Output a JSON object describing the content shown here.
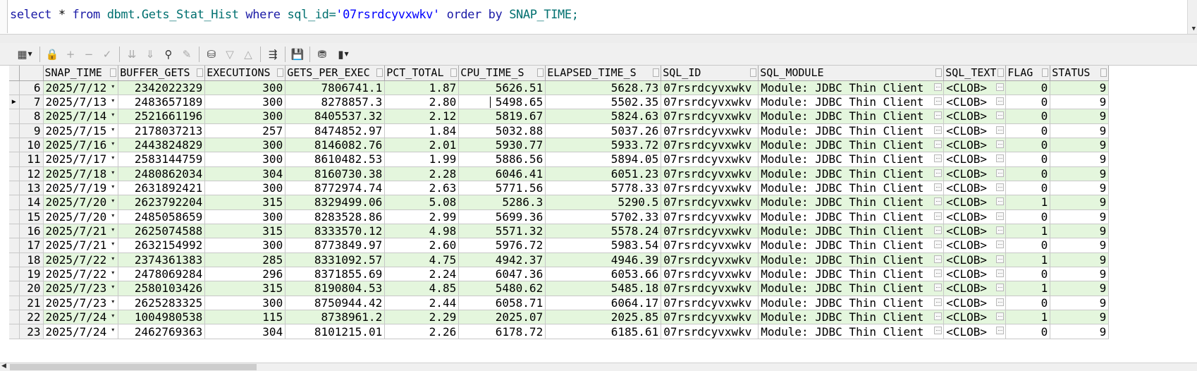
{
  "editor": {
    "sql_tokens": [
      {
        "t": "select",
        "c": "kw"
      },
      {
        "t": " * ",
        "c": "op"
      },
      {
        "t": "from",
        "c": "kw"
      },
      {
        "t": " dbmt.Gets_Stat_Hist ",
        "c": "obj"
      },
      {
        "t": "where",
        "c": "kw"
      },
      {
        "t": " sql_id=",
        "c": "obj"
      },
      {
        "t": "'07rsrdcyvxwkv'",
        "c": "str"
      },
      {
        "t": " order by ",
        "c": "kw"
      },
      {
        "t": "SNAP_TIME",
        "c": "obj"
      },
      {
        "t": ";",
        "c": "obj"
      }
    ]
  },
  "toolbar": {
    "buttons": [
      {
        "name": "grid-view-icon",
        "glyph": "▦",
        "dropdown": true,
        "enabled": true
      },
      {
        "sep": true
      },
      {
        "name": "lock-icon",
        "glyph": "🔒",
        "enabled": true
      },
      {
        "name": "insert-record-icon",
        "glyph": "+",
        "enabled": false
      },
      {
        "name": "delete-record-icon",
        "glyph": "−",
        "enabled": false
      },
      {
        "name": "post-changes-icon",
        "glyph": "✓",
        "enabled": false
      },
      {
        "sep": true
      },
      {
        "name": "fetch-next-icon",
        "glyph": "⇊",
        "enabled": false
      },
      {
        "name": "fetch-last-icon",
        "glyph": "⇓",
        "enabled": false
      },
      {
        "name": "find-icon",
        "glyph": "⚲",
        "enabled": true
      },
      {
        "name": "clear-icon",
        "glyph": "✎",
        "enabled": false
      },
      {
        "sep": true
      },
      {
        "name": "query-by-example-icon",
        "glyph": "⛁",
        "enabled": true
      },
      {
        "name": "filter-icon",
        "glyph": "▽",
        "enabled": false
      },
      {
        "name": "clear-filter-icon",
        "glyph": "△",
        "enabled": false
      },
      {
        "sep": true
      },
      {
        "name": "explain-plan-icon",
        "glyph": "⇶",
        "enabled": true
      },
      {
        "sep": true
      },
      {
        "name": "save-icon",
        "glyph": "💾",
        "enabled": true
      },
      {
        "sep": true
      },
      {
        "name": "export-icon",
        "glyph": "⛃",
        "enabled": true
      },
      {
        "name": "chart-icon",
        "glyph": "▮",
        "dropdown": true,
        "enabled": true
      }
    ]
  },
  "grid": {
    "columns": [
      {
        "key": "SNAP_TIME",
        "label": "SNAP_TIME",
        "width": 104,
        "align": "left",
        "dd": true
      },
      {
        "key": "BUFFER_GETS",
        "label": "BUFFER_GETS",
        "width": 123,
        "align": "right"
      },
      {
        "key": "EXECUTIONS",
        "label": "EXECUTIONS",
        "width": 114,
        "align": "right"
      },
      {
        "key": "GETS_PER_EXEC",
        "label": "GETS_PER_EXEC",
        "width": 141,
        "align": "right"
      },
      {
        "key": "PCT_TOTAL",
        "label": "PCT_TOTAL",
        "width": 105,
        "align": "right"
      },
      {
        "key": "CPU_TIME_S",
        "label": "CPU_TIME_S",
        "width": 123,
        "align": "right"
      },
      {
        "key": "ELAPSED_TIME_S",
        "label": "ELAPSED_TIME_S",
        "width": 164,
        "align": "right"
      },
      {
        "key": "SQL_ID",
        "label": "SQL_ID",
        "width": 138,
        "align": "left"
      },
      {
        "key": "SQL_MODULE",
        "label": "SQL_MODULE",
        "width": 263,
        "align": "left",
        "btn": true
      },
      {
        "key": "SQL_TEXT",
        "label": "SQL_TEXT",
        "width": 88,
        "align": "left",
        "btn": true
      },
      {
        "key": "FLAG",
        "label": "FLAG",
        "width": 63,
        "align": "right"
      },
      {
        "key": "STATUS",
        "label": "STATUS",
        "width": 83,
        "align": "right"
      }
    ],
    "current_row": 7,
    "rows": [
      {
        "n": "6",
        "SNAP_TIME": "2025/7/12",
        "BUFFER_GETS": "2342022329",
        "EXECUTIONS": "300",
        "GETS_PER_EXEC": "7806741.1",
        "PCT_TOTAL": "1.87",
        "CPU_TIME_S": "5626.51",
        "ELAPSED_TIME_S": "5628.73",
        "SQL_ID": "07rsrdcyvxwkv",
        "SQL_MODULE": "Module: JDBC Thin Client",
        "SQL_TEXT": "<CLOB>",
        "FLAG": "0",
        "STATUS": "9"
      },
      {
        "n": "7",
        "SNAP_TIME": "2025/7/13",
        "BUFFER_GETS": "2483657189",
        "EXECUTIONS": "300",
        "GETS_PER_EXEC": "8278857.3",
        "PCT_TOTAL": "2.80",
        "CPU_TIME_S": "5498.65",
        "ELAPSED_TIME_S": "5502.35",
        "SQL_ID": "07rsrdcyvxwkv",
        "SQL_MODULE": "Module: JDBC Thin Client",
        "SQL_TEXT": "<CLOB>",
        "FLAG": "0",
        "STATUS": "9"
      },
      {
        "n": "8",
        "SNAP_TIME": "2025/7/14",
        "BUFFER_GETS": "2521661196",
        "EXECUTIONS": "300",
        "GETS_PER_EXEC": "8405537.32",
        "PCT_TOTAL": "2.12",
        "CPU_TIME_S": "5819.67",
        "ELAPSED_TIME_S": "5824.63",
        "SQL_ID": "07rsrdcyvxwkv",
        "SQL_MODULE": "Module: JDBC Thin Client",
        "SQL_TEXT": "<CLOB>",
        "FLAG": "0",
        "STATUS": "9"
      },
      {
        "n": "9",
        "SNAP_TIME": "2025/7/15",
        "BUFFER_GETS": "2178037213",
        "EXECUTIONS": "257",
        "GETS_PER_EXEC": "8474852.97",
        "PCT_TOTAL": "1.84",
        "CPU_TIME_S": "5032.88",
        "ELAPSED_TIME_S": "5037.26",
        "SQL_ID": "07rsrdcyvxwkv",
        "SQL_MODULE": "Module: JDBC Thin Client",
        "SQL_TEXT": "<CLOB>",
        "FLAG": "0",
        "STATUS": "9"
      },
      {
        "n": "10",
        "SNAP_TIME": "2025/7/16",
        "BUFFER_GETS": "2443824829",
        "EXECUTIONS": "300",
        "GETS_PER_EXEC": "8146082.76",
        "PCT_TOTAL": "2.01",
        "CPU_TIME_S": "5930.77",
        "ELAPSED_TIME_S": "5933.72",
        "SQL_ID": "07rsrdcyvxwkv",
        "SQL_MODULE": "Module: JDBC Thin Client",
        "SQL_TEXT": "<CLOB>",
        "FLAG": "0",
        "STATUS": "9"
      },
      {
        "n": "11",
        "SNAP_TIME": "2025/7/17",
        "BUFFER_GETS": "2583144759",
        "EXECUTIONS": "300",
        "GETS_PER_EXEC": "8610482.53",
        "PCT_TOTAL": "1.99",
        "CPU_TIME_S": "5886.56",
        "ELAPSED_TIME_S": "5894.05",
        "SQL_ID": "07rsrdcyvxwkv",
        "SQL_MODULE": "Module: JDBC Thin Client",
        "SQL_TEXT": "<CLOB>",
        "FLAG": "0",
        "STATUS": "9"
      },
      {
        "n": "12",
        "SNAP_TIME": "2025/7/18",
        "BUFFER_GETS": "2480862034",
        "EXECUTIONS": "304",
        "GETS_PER_EXEC": "8160730.38",
        "PCT_TOTAL": "2.28",
        "CPU_TIME_S": "6046.41",
        "ELAPSED_TIME_S": "6051.23",
        "SQL_ID": "07rsrdcyvxwkv",
        "SQL_MODULE": "Module: JDBC Thin Client",
        "SQL_TEXT": "<CLOB>",
        "FLAG": "0",
        "STATUS": "9"
      },
      {
        "n": "13",
        "SNAP_TIME": "2025/7/19",
        "BUFFER_GETS": "2631892421",
        "EXECUTIONS": "300",
        "GETS_PER_EXEC": "8772974.74",
        "PCT_TOTAL": "2.63",
        "CPU_TIME_S": "5771.56",
        "ELAPSED_TIME_S": "5778.33",
        "SQL_ID": "07rsrdcyvxwkv",
        "SQL_MODULE": "Module: JDBC Thin Client",
        "SQL_TEXT": "<CLOB>",
        "FLAG": "0",
        "STATUS": "9"
      },
      {
        "n": "14",
        "SNAP_TIME": "2025/7/20",
        "BUFFER_GETS": "2623792204",
        "EXECUTIONS": "315",
        "GETS_PER_EXEC": "8329499.06",
        "PCT_TOTAL": "5.08",
        "CPU_TIME_S": "5286.3",
        "ELAPSED_TIME_S": "5290.5",
        "SQL_ID": "07rsrdcyvxwkv",
        "SQL_MODULE": "Module: JDBC Thin Client",
        "SQL_TEXT": "<CLOB>",
        "FLAG": "1",
        "STATUS": "9"
      },
      {
        "n": "15",
        "SNAP_TIME": "2025/7/20",
        "BUFFER_GETS": "2485058659",
        "EXECUTIONS": "300",
        "GETS_PER_EXEC": "8283528.86",
        "PCT_TOTAL": "2.99",
        "CPU_TIME_S": "5699.36",
        "ELAPSED_TIME_S": "5702.33",
        "SQL_ID": "07rsrdcyvxwkv",
        "SQL_MODULE": "Module: JDBC Thin Client",
        "SQL_TEXT": "<CLOB>",
        "FLAG": "0",
        "STATUS": "9"
      },
      {
        "n": "16",
        "SNAP_TIME": "2025/7/21",
        "BUFFER_GETS": "2625074588",
        "EXECUTIONS": "315",
        "GETS_PER_EXEC": "8333570.12",
        "PCT_TOTAL": "4.98",
        "CPU_TIME_S": "5571.32",
        "ELAPSED_TIME_S": "5578.24",
        "SQL_ID": "07rsrdcyvxwkv",
        "SQL_MODULE": "Module: JDBC Thin Client",
        "SQL_TEXT": "<CLOB>",
        "FLAG": "1",
        "STATUS": "9"
      },
      {
        "n": "17",
        "SNAP_TIME": "2025/7/21",
        "BUFFER_GETS": "2632154992",
        "EXECUTIONS": "300",
        "GETS_PER_EXEC": "8773849.97",
        "PCT_TOTAL": "2.60",
        "CPU_TIME_S": "5976.72",
        "ELAPSED_TIME_S": "5983.54",
        "SQL_ID": "07rsrdcyvxwkv",
        "SQL_MODULE": "Module: JDBC Thin Client",
        "SQL_TEXT": "<CLOB>",
        "FLAG": "0",
        "STATUS": "9"
      },
      {
        "n": "18",
        "SNAP_TIME": "2025/7/22",
        "BUFFER_GETS": "2374361383",
        "EXECUTIONS": "285",
        "GETS_PER_EXEC": "8331092.57",
        "PCT_TOTAL": "4.75",
        "CPU_TIME_S": "4942.37",
        "ELAPSED_TIME_S": "4946.39",
        "SQL_ID": "07rsrdcyvxwkv",
        "SQL_MODULE": "Module: JDBC Thin Client",
        "SQL_TEXT": "<CLOB>",
        "FLAG": "1",
        "STATUS": "9"
      },
      {
        "n": "19",
        "SNAP_TIME": "2025/7/22",
        "BUFFER_GETS": "2478069284",
        "EXECUTIONS": "296",
        "GETS_PER_EXEC": "8371855.69",
        "PCT_TOTAL": "2.24",
        "CPU_TIME_S": "6047.36",
        "ELAPSED_TIME_S": "6053.66",
        "SQL_ID": "07rsrdcyvxwkv",
        "SQL_MODULE": "Module: JDBC Thin Client",
        "SQL_TEXT": "<CLOB>",
        "FLAG": "0",
        "STATUS": "9"
      },
      {
        "n": "20",
        "SNAP_TIME": "2025/7/23",
        "BUFFER_GETS": "2580103426",
        "EXECUTIONS": "315",
        "GETS_PER_EXEC": "8190804.53",
        "PCT_TOTAL": "4.85",
        "CPU_TIME_S": "5480.62",
        "ELAPSED_TIME_S": "5485.18",
        "SQL_ID": "07rsrdcyvxwkv",
        "SQL_MODULE": "Module: JDBC Thin Client",
        "SQL_TEXT": "<CLOB>",
        "FLAG": "1",
        "STATUS": "9"
      },
      {
        "n": "21",
        "SNAP_TIME": "2025/7/23",
        "BUFFER_GETS": "2625283325",
        "EXECUTIONS": "300",
        "GETS_PER_EXEC": "8750944.42",
        "PCT_TOTAL": "2.44",
        "CPU_TIME_S": "6058.71",
        "ELAPSED_TIME_S": "6064.17",
        "SQL_ID": "07rsrdcyvxwkv",
        "SQL_MODULE": "Module: JDBC Thin Client",
        "SQL_TEXT": "<CLOB>",
        "FLAG": "0",
        "STATUS": "9"
      },
      {
        "n": "22",
        "SNAP_TIME": "2025/7/24",
        "BUFFER_GETS": "1004980538",
        "EXECUTIONS": "115",
        "GETS_PER_EXEC": "8738961.2",
        "PCT_TOTAL": "2.29",
        "CPU_TIME_S": "2025.07",
        "ELAPSED_TIME_S": "2025.85",
        "SQL_ID": "07rsrdcyvxwkv",
        "SQL_MODULE": "Module: JDBC Thin Client",
        "SQL_TEXT": "<CLOB>",
        "FLAG": "1",
        "STATUS": "9"
      },
      {
        "n": "23",
        "SNAP_TIME": "2025/7/24",
        "BUFFER_GETS": "2462769363",
        "EXECUTIONS": "304",
        "GETS_PER_EXEC": "8101215.01",
        "PCT_TOTAL": "2.26",
        "CPU_TIME_S": "6178.72",
        "ELAPSED_TIME_S": "6185.61",
        "SQL_ID": "07rsrdcyvxwkv",
        "SQL_MODULE": "Module: JDBC Thin Client",
        "SQL_TEXT": "<CLOB>",
        "FLAG": "0",
        "STATUS": "9"
      }
    ]
  }
}
